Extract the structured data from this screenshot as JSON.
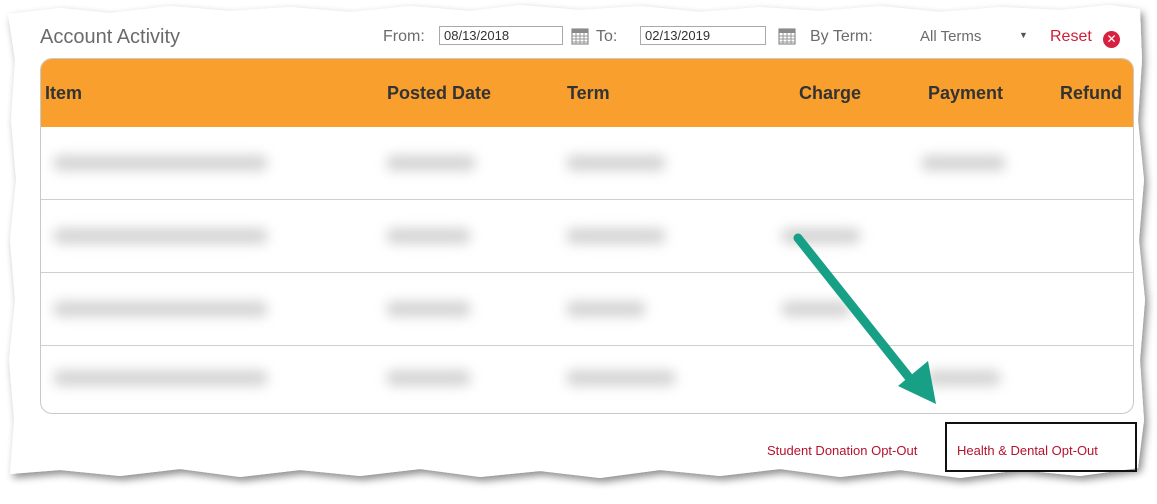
{
  "header": {
    "title": "Account Activity",
    "from_label": "From:",
    "from_value": "08/13/2018",
    "to_label": "To:",
    "to_value": "02/13/2019",
    "by_term_label": "By Term:",
    "term_selected": "All Terms",
    "reset_label": "Reset",
    "calendar_icon": "calendar-icon",
    "reset_icon": "close-circle-icon"
  },
  "table": {
    "columns": [
      "Item",
      "Posted Date",
      "Term",
      "Charge",
      "Payment",
      "Refund"
    ],
    "rows_note_visible": false,
    "header_color": "#f99f2d"
  },
  "footer": {
    "student_donation_link": "Student Donation Opt-Out",
    "health_dental_link": "Health & Dental Opt-Out"
  },
  "annotation": {
    "arrow_color": "#17a085"
  },
  "colors": {
    "accent": "#f99f2d",
    "link": "#b5122f",
    "reset": "#cc1f3a"
  }
}
